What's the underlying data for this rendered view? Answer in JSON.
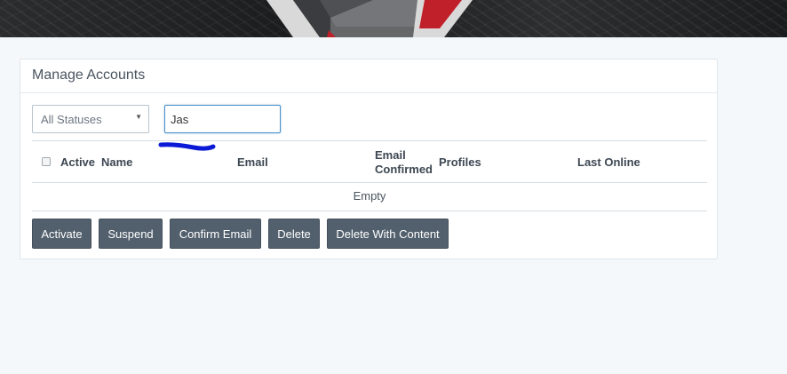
{
  "panel": {
    "title": "Manage Accounts"
  },
  "filters": {
    "status_value": "All Statuses",
    "search_value": "Jas"
  },
  "table": {
    "columns": {
      "active": "Active",
      "name": "Name",
      "email": "Email",
      "email_confirmed_line1": "Email",
      "email_confirmed_line2": "Confirmed",
      "profiles": "Profiles",
      "last_online": "Last Online"
    },
    "empty_text": "Empty"
  },
  "actions": {
    "activate": "Activate",
    "suspend": "Suspend",
    "confirm_email": "Confirm Email",
    "delete": "Delete",
    "delete_with_content": "Delete With Content"
  },
  "colors": {
    "button": "#52606d",
    "page_background": "#f4f8fb",
    "input_focus_border": "#4a90c8",
    "scribble": "#0a1ad6"
  }
}
